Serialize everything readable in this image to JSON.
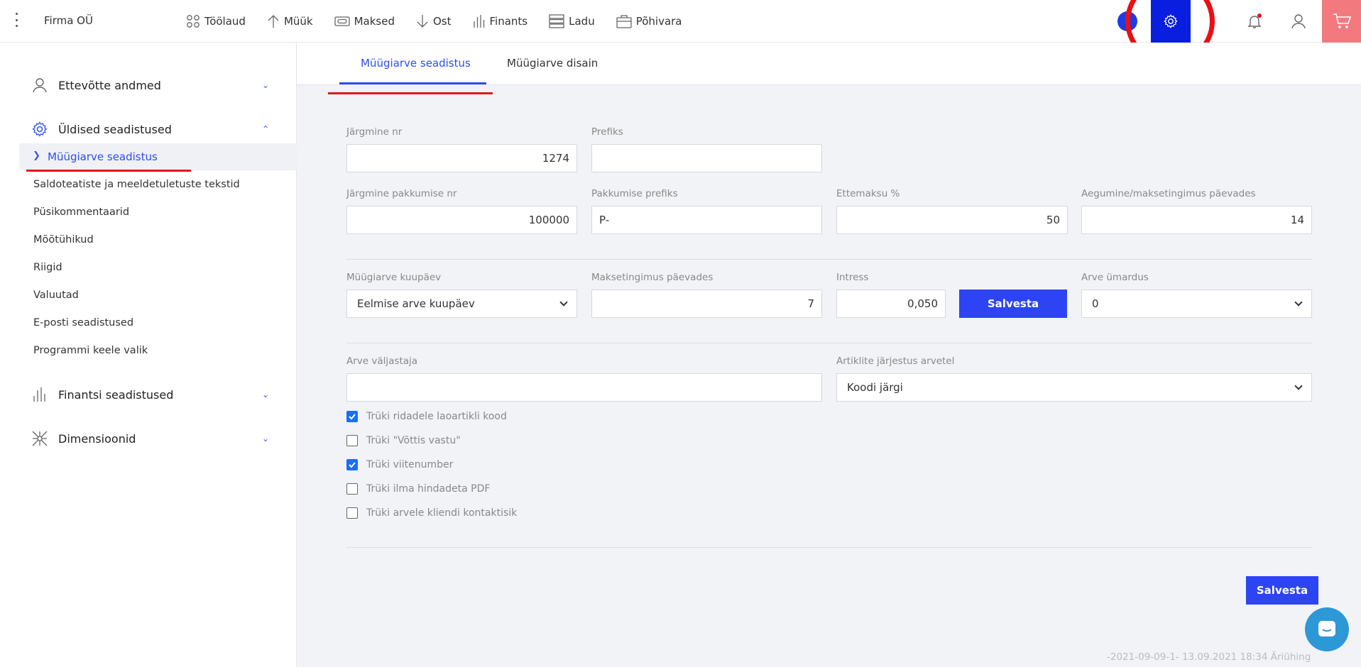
{
  "header": {
    "company": "Firma OÜ",
    "nav": [
      {
        "label": "Töölaud",
        "icon": "dashboard-icon"
      },
      {
        "label": "Müük",
        "icon": "arrow-up-icon"
      },
      {
        "label": "Maksed",
        "icon": "money-icon"
      },
      {
        "label": "Ost",
        "icon": "arrow-down-icon"
      },
      {
        "label": "Finants",
        "icon": "bar-chart-icon"
      },
      {
        "label": "Ladu",
        "icon": "warehouse-icon"
      },
      {
        "label": "Põhivara",
        "icon": "briefcase-icon"
      }
    ],
    "accent": "#0a1ee0",
    "highlight": "#ea0f14"
  },
  "sidebar": {
    "sections": [
      {
        "label": "Ettevõtte andmed",
        "icon": "user-icon",
        "expanded": false
      },
      {
        "label": "Üldised seadistused",
        "icon": "gear-icon",
        "expanded": true
      },
      {
        "label": "Finantsi seadistused",
        "icon": "bar-chart-icon",
        "expanded": false
      },
      {
        "label": "Dimensioonid",
        "icon": "dimensions-icon",
        "expanded": false
      }
    ],
    "active_item": "Müügiarve seadistus",
    "sub_items": [
      "Saldoteatiste ja meeldetuletuste tekstid",
      "Püsikommentaarid",
      "Mõõtühikud",
      "Riigid",
      "Valuutad",
      "E-posti seadistused",
      "Programmi keele valik"
    ]
  },
  "tabs": [
    {
      "label": "Müügiarve seadistus",
      "active": true
    },
    {
      "label": "Müügiarve disain",
      "active": false
    }
  ],
  "form": {
    "next_nr": {
      "label": "Järgmine nr",
      "value": "1274"
    },
    "prefix": {
      "label": "Prefiks",
      "value": ""
    },
    "next_offer_nr": {
      "label": "Järgmine pakkumise nr",
      "value": "100000"
    },
    "offer_prefix": {
      "label": "Pakkumise prefiks",
      "value": "P-"
    },
    "prepayment": {
      "label": "Ettemaksu %",
      "value": "50"
    },
    "expiry_days": {
      "label": "Aegumine/maksetingimus päevades",
      "value": "14"
    },
    "invoice_date": {
      "label": "Müügiarve kuupäev",
      "value": "Eelmise arve kuupäev"
    },
    "payment_days": {
      "label": "Maksetingimus päevades",
      "value": "7"
    },
    "interest": {
      "label": "Intress",
      "value": "0,050"
    },
    "save_small": "Salvesta",
    "rounding": {
      "label": "Arve ümardus",
      "value": "0"
    },
    "issuer": {
      "label": "Arve väljastaja",
      "value": ""
    },
    "article_order": {
      "label": "Artiklite järjestus arvetel",
      "value": "Koodi järgi"
    },
    "checkboxes": [
      {
        "label": "Trüki ridadele laoartikli kood",
        "checked": true
      },
      {
        "label": "Trüki \"Võttis vastu\"",
        "checked": false
      },
      {
        "label": "Trüki viitenumber",
        "checked": true
      },
      {
        "label": "Trüki ilma hindadeta PDF",
        "checked": false
      },
      {
        "label": "Trüki arvele kliendi kontaktisik",
        "checked": false
      }
    ],
    "save_main": "Salvesta"
  },
  "footer": {
    "text": "-2021-09-09-1- 13.09.2021 18:34 Äriühing"
  }
}
